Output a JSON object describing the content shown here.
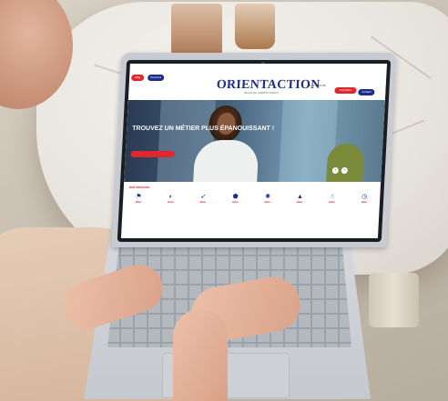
{
  "website": {
    "top_buttons": {
      "left_red": "Blog",
      "left_blue": "Recrutez"
    },
    "brand": {
      "name": "ORIENTACTION",
      "tagline": "BILAN DE COMPÉTENCES"
    },
    "contact": {
      "phone": "09 72 12 55 66",
      "line2": "",
      "line3": ""
    },
    "right_buttons": {
      "red": "Inscription",
      "blue": "Contact"
    },
    "hero": {
      "title": "TROUVEZ UN MÉTIER PLUS ÉPANOUISSANT !",
      "subtitle": "",
      "cta": "",
      "arrow_prev": "‹",
      "arrow_next": "›"
    },
    "services_label": "NOS SERVICES",
    "services": [
      {
        "icon": "signpost-icon",
        "glyph": "⚑",
        "label": "Bilan"
      },
      {
        "icon": "compass-icon",
        "glyph": "◐",
        "label": "Bilan"
      },
      {
        "icon": "runner-icon",
        "glyph": "➶",
        "label": "Bilan"
      },
      {
        "icon": "badge-icon",
        "glyph": "⬟",
        "label": "Bilan"
      },
      {
        "icon": "lightbulb-icon",
        "glyph": "✺",
        "label": "Bilan"
      },
      {
        "icon": "graduation-cap-icon",
        "glyph": "▲",
        "label": "Bilan"
      },
      {
        "icon": "hand-icon",
        "glyph": "☝",
        "label": "Bilan"
      },
      {
        "icon": "stopwatch-icon",
        "glyph": "◷",
        "label": "Bilan"
      }
    ]
  },
  "colors": {
    "brand_blue": "#1c2d8f",
    "brand_red": "#e0262f",
    "marble": "#efece7",
    "laptop_silver": "#c8ccd2"
  }
}
